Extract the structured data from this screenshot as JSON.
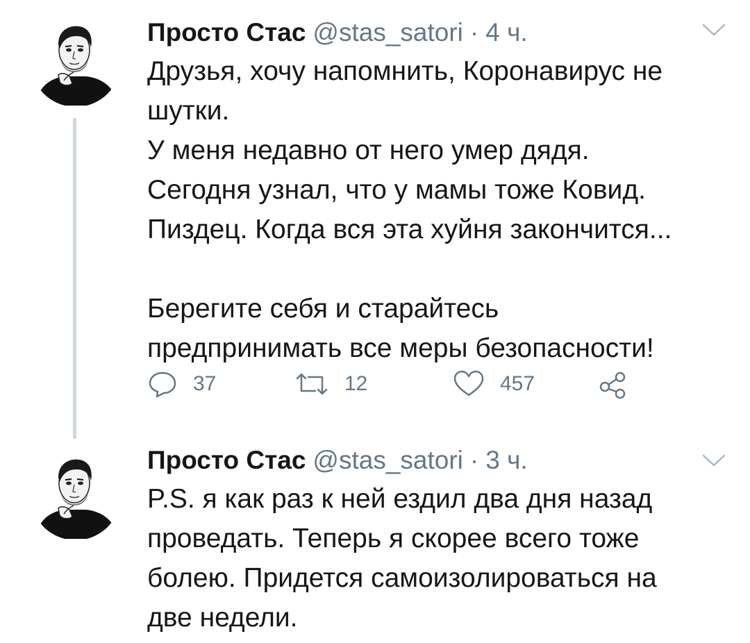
{
  "tweets": [
    {
      "display_name": "Просто Стас",
      "handle": "@stas_satori",
      "separator": "·",
      "time": "4 ч.",
      "lines": [
        "Друзья, хочу напомнить, Коронавирус не",
        "шутки.",
        "У меня недавно от него умер дядя.",
        "Сегодня узнал, что у мамы тоже Ковид.",
        "Пиздец. Когда вся эта хуйня закончится...",
        "",
        "Берегите себя и старайтесь",
        "предпринимать все меры безопасности!"
      ],
      "actions": {
        "replies": "37",
        "retweets": "12",
        "likes": "457"
      }
    },
    {
      "display_name": "Просто Стас",
      "handle": "@stas_satori",
      "separator": "·",
      "time": "3 ч.",
      "lines": [
        "P.S. я как раз к ней ездил два дня назад",
        "проведать. Теперь я скорее всего тоже",
        "болею. Придется самоизолироваться на",
        "две недели."
      ]
    }
  ],
  "icons": {
    "reply": "reply-icon",
    "retweet": "retweet-icon",
    "like": "heart-icon",
    "share": "share-icon",
    "menu": "chevron-down-icon",
    "avatar": "avatar"
  },
  "colors": {
    "text": "#14171a",
    "secondary": "#657786",
    "thread_line": "#ccd6dd"
  }
}
